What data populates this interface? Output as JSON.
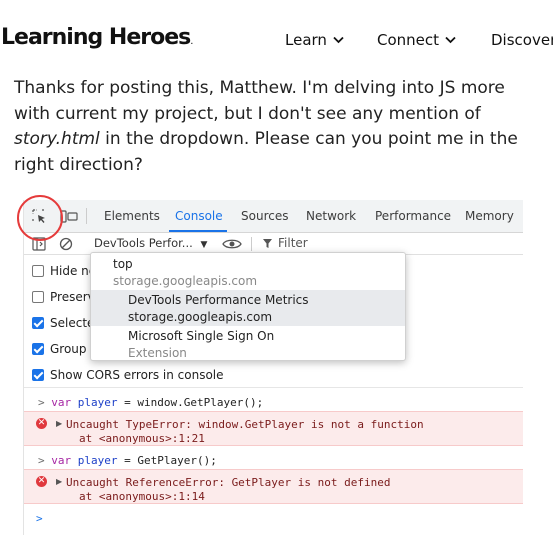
{
  "header": {
    "logo": "Learning Heroes",
    "logo_dot": ".",
    "nav": [
      "Learn",
      "Connect",
      "Discover"
    ]
  },
  "post": {
    "line1": "Thanks for posting this, Matthew. I'm delving into JS more",
    "line2": "with current my project, but I don't see any mention of",
    "line3_em": "story.html",
    "line3_rest": " in the dropdown. Please can you point me in the",
    "line4": "right direction?"
  },
  "devtools": {
    "tabs": [
      "Elements",
      "Console",
      "Sources",
      "Network",
      "Performance",
      "Memory"
    ],
    "active_tab": "Console",
    "context_selector": "DevTools Perfor...",
    "filter_label": "Filter",
    "settings": [
      {
        "label": "Hide ne",
        "checked": false
      },
      {
        "label": "Preserve",
        "checked": false
      },
      {
        "label": "Selected",
        "checked": true
      },
      {
        "label": "Group s",
        "checked": true
      },
      {
        "label": "Show CORS errors in console",
        "checked": true
      }
    ],
    "console": {
      "cmd1": {
        "prompt": ">",
        "keyword": "var",
        "name": "player",
        "rest": " = window.GetPlayer();"
      },
      "err1": {
        "line1": "Uncaught TypeError: window.GetPlayer is not a function",
        "line2": "at <anonymous>:1:21"
      },
      "cmd2": {
        "prompt": ">",
        "keyword": "var",
        "name": "player",
        "rest": " = GetPlayer();"
      },
      "err2": {
        "line1": "Uncaught ReferenceError: GetPlayer is not defined",
        "line2": "at <anonymous>:1:14"
      },
      "input_prompt": ">"
    },
    "dropdown": [
      {
        "title": "top",
        "subtitle": "storage.googleapis.com"
      },
      {
        "title": "DevTools Performance Metrics",
        "subtitle": "storage.googleapis.com"
      },
      {
        "title": "Microsoft Single Sign On",
        "subtitle": "Extension"
      }
    ]
  },
  "colors": {
    "accent": "#1a73e8",
    "error_bg": "#fcebeb",
    "annotation": "#e53b3b"
  }
}
